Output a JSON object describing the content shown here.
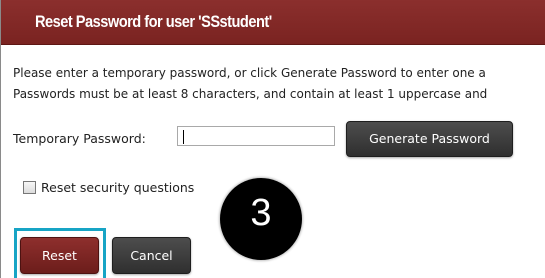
{
  "dialog": {
    "title": "Reset Password for user 'SSstudent'",
    "message_line1": "Please enter a temporary password, or click Generate Password to enter one a",
    "message_line2": "Passwords must be at least 8 characters, and contain at least 1 uppercase and",
    "temp_password_label": "Temporary Password:",
    "temp_password_value": "",
    "generate_button_label": "Generate Password",
    "reset_security_questions_label": "Reset security questions",
    "reset_security_questions_checked": false,
    "reset_button_label": "Reset",
    "cancel_button_label": "Cancel"
  },
  "annotation": {
    "step_number": "3"
  },
  "colors": {
    "title_bar": "#7a2321",
    "reset_button": "#7a2321",
    "dark_button": "#3a3a3a",
    "highlight_box": "#17a4c5",
    "step_badge": "#000000"
  }
}
